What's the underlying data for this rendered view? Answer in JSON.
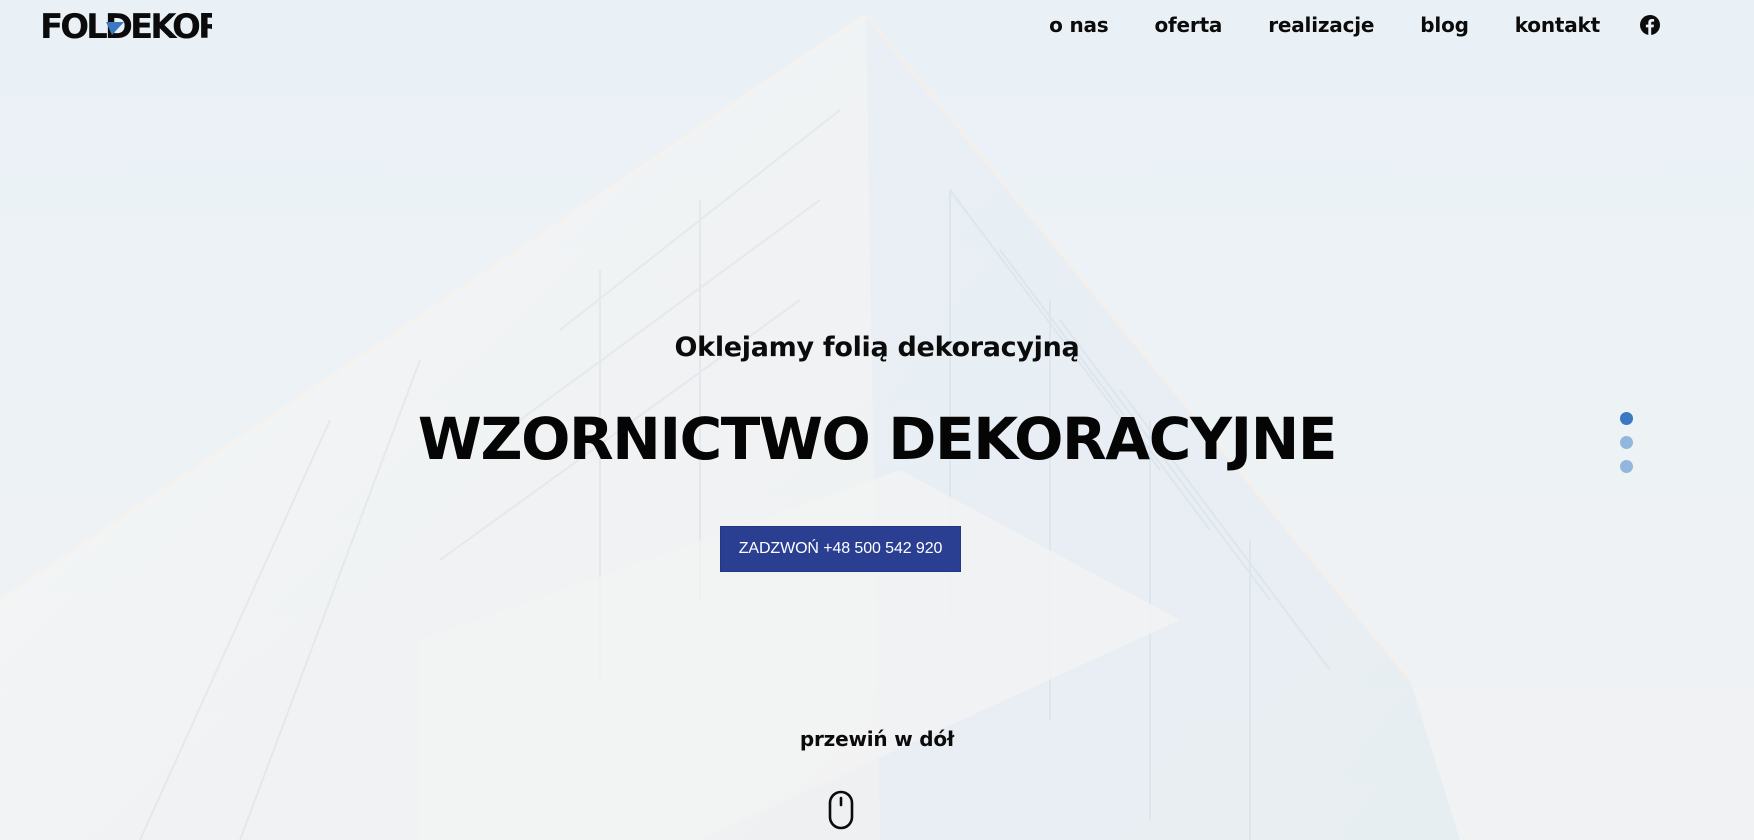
{
  "header": {
    "logo_text": "FOLDEKOR",
    "nav": [
      {
        "label": "o nas"
      },
      {
        "label": "oferta"
      },
      {
        "label": "realizacje"
      },
      {
        "label": "blog"
      },
      {
        "label": "kontakt"
      }
    ],
    "social_icon": "facebook-icon"
  },
  "hero": {
    "subtitle": "Oklejamy folią dekoracyjną",
    "title": "WZORNICTWO DEKORACYJNE",
    "cta_label": "ZADZWOŃ +48 500 542 920"
  },
  "slider": {
    "active_index": 0,
    "count": 3
  },
  "scroll": {
    "label": "przewiń w dół",
    "icon": "mouse-icon"
  },
  "colors": {
    "accent": "#2b3f92",
    "dot_active": "#3b78c2",
    "dot_inactive": "#93b6dc",
    "logo_accent": "#3b78c2",
    "text": "#0b0b0b"
  }
}
